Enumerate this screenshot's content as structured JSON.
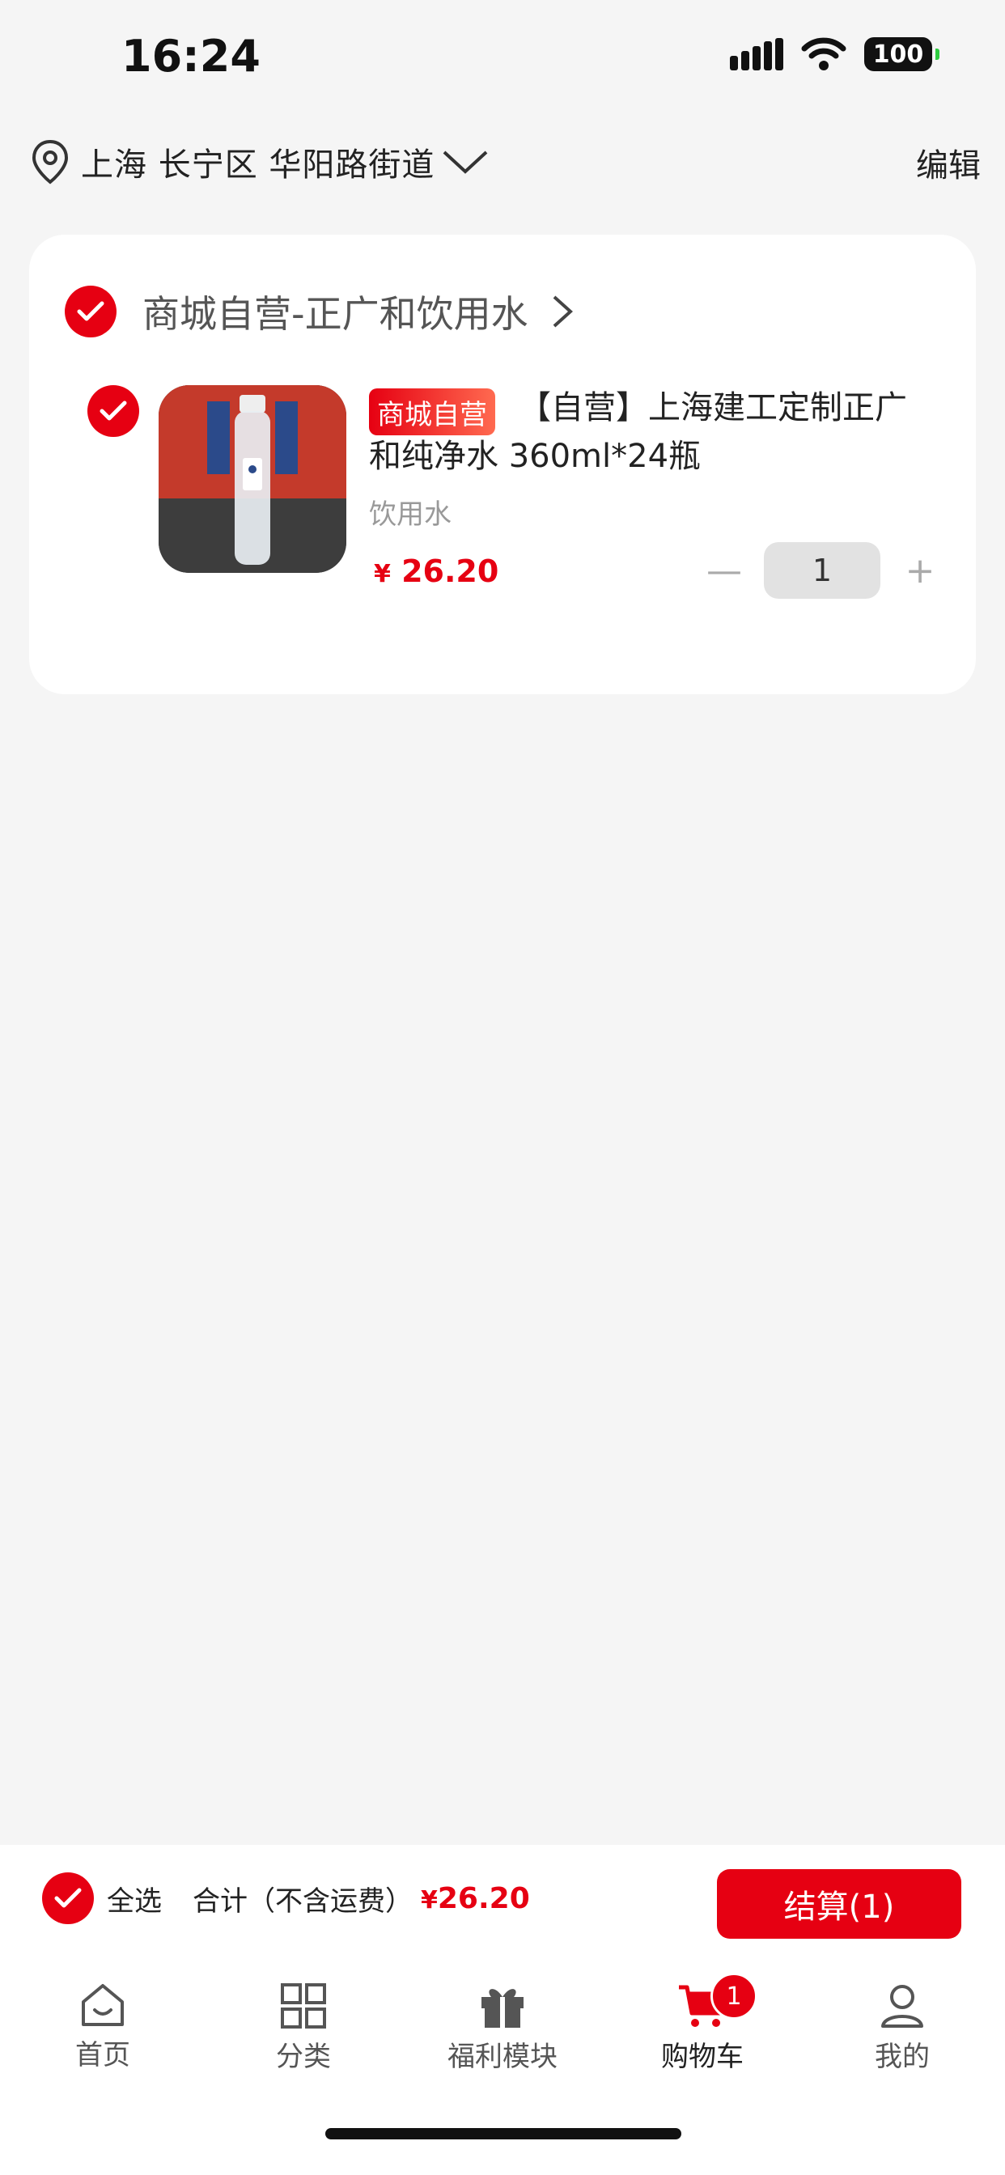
{
  "status_bar": {
    "time": "16:24",
    "battery": "100"
  },
  "header": {
    "location": "上海 长宁区 华阳路街道",
    "edit_label": "编辑"
  },
  "cart": {
    "store_name": "商城自营-正广和饮用水",
    "item": {
      "tag": "商城自营",
      "title": "【自营】上海建工定制正广和纯净水 360ml*24瓶",
      "category": "饮用水",
      "price_symbol": "¥",
      "price": "26.20",
      "quantity": "1",
      "minus": "—",
      "plus": "+"
    }
  },
  "checkout": {
    "select_all": "全选",
    "total_label": "合计（不含运费）",
    "total_symbol": "¥",
    "total": "26.20",
    "pay_button": "结算(1)"
  },
  "tabs": [
    {
      "label": "首页",
      "icon": "home-icon"
    },
    {
      "label": "分类",
      "icon": "grid-icon"
    },
    {
      "label": "福利模块",
      "icon": "gift-icon"
    },
    {
      "label": "购物车",
      "icon": "cart-icon",
      "badge": "1"
    },
    {
      "label": "我的",
      "icon": "user-icon"
    }
  ],
  "colors": {
    "accent": "#e60012",
    "background": "#f5f5f5"
  }
}
